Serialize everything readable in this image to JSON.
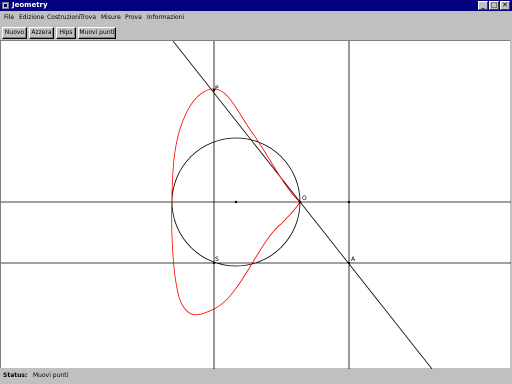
{
  "window": {
    "title": "Jeometry",
    "controls": {
      "minimize": "_",
      "maximize": "□",
      "close": "✕"
    }
  },
  "menu": {
    "items": [
      "File",
      "Edizione",
      "Costruzioni",
      "Trova",
      "Misure",
      "Prova",
      "Informazioni"
    ]
  },
  "toolbar": {
    "buttons": [
      "Nuovo",
      "Azzera",
      "Hips",
      "Muovi punti"
    ]
  },
  "canvas": {
    "points": {
      "P": "P",
      "O": "O",
      "A": "A",
      "S": "S"
    },
    "colors": {
      "construction": "#000000",
      "locus": "#ff0000",
      "background": "#ffffff"
    }
  },
  "status": {
    "label": "Status:",
    "value": "Muovi punti"
  }
}
